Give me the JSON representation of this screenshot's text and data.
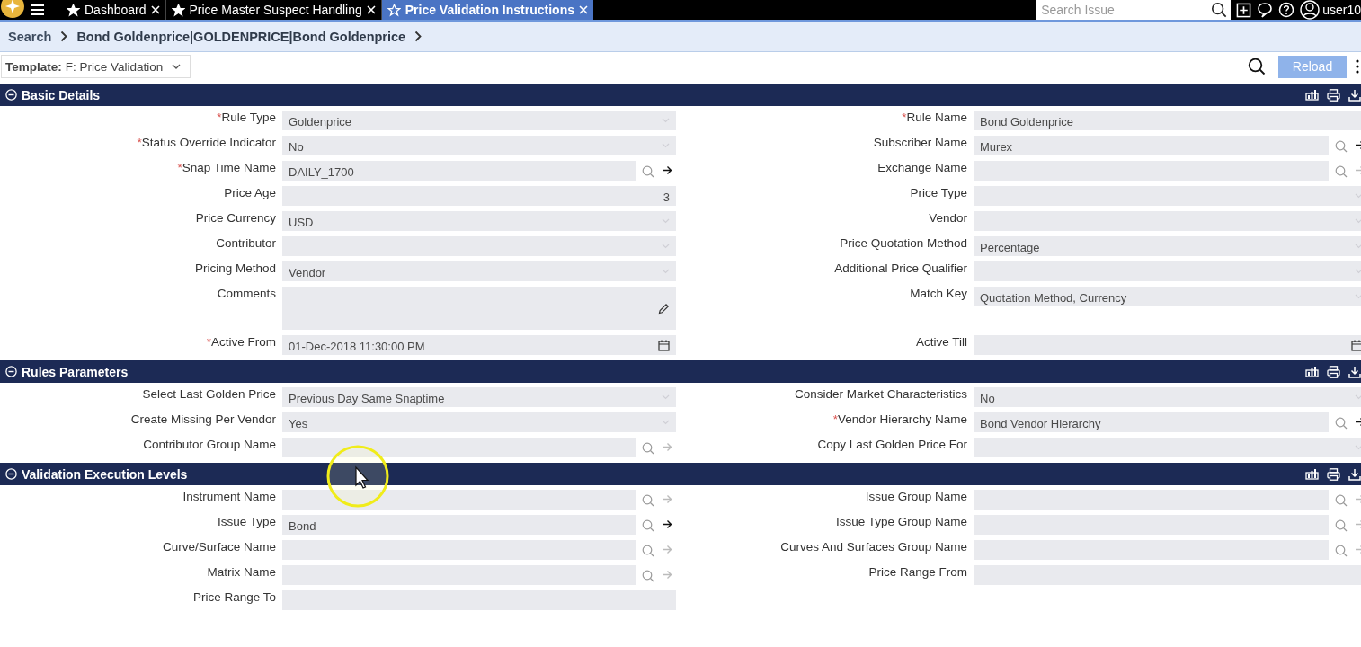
{
  "top_bar": {
    "tabs": [
      {
        "label": "Dashboard",
        "selected": false
      },
      {
        "label": "Price Master Suspect Handling",
        "selected": false
      },
      {
        "label": "Price Validation Instructions",
        "selected": true
      }
    ],
    "search": {
      "placeholder": "Search Issue"
    },
    "user": "user10"
  },
  "breadcrumb": [
    "Search",
    "Bond Goldenprice|GOLDENPRICE|Bond Goldenprice"
  ],
  "template": {
    "label": "Template:",
    "value": "F: Price Validation"
  },
  "reload": {
    "label": "Reload",
    "disabled": true
  },
  "sections": [
    {
      "title": "Basic Details",
      "expanded": true,
      "rows": [
        {
          "left": {
            "label": "Rule Type",
            "required_mark": "*",
            "kind": "select",
            "value": "Goldenprice"
          },
          "right": {
            "label": "Rule Name",
            "required_mark": "*",
            "kind": "text",
            "value": "Bond Goldenprice"
          }
        },
        {
          "left": {
            "label": "Status Override Indicator",
            "required_mark": "*",
            "kind": "select",
            "value": "No"
          },
          "right": {
            "label": "Subscriber Name",
            "kind": "lookup",
            "value": "Murex",
            "link_enabled": true
          }
        },
        {
          "left": {
            "label": "Snap Time Name",
            "required_mark": "*",
            "kind": "lookup",
            "value": "DAILY_1700",
            "link_enabled": true
          },
          "right": {
            "label": "Exchange Name",
            "kind": "lookup",
            "link_enabled": false
          }
        },
        {
          "left": {
            "label": "Price Age",
            "kind": "number",
            "value": "3"
          },
          "right": {
            "label": "Price Type",
            "kind": "select"
          }
        },
        {
          "left": {
            "label": "Price Currency",
            "kind": "select",
            "value": "USD"
          },
          "right": {
            "label": "Vendor",
            "kind": "select"
          }
        },
        {
          "left": {
            "label": "Contributor",
            "kind": "select"
          },
          "right": {
            "label": "Price Quotation Method",
            "kind": "select",
            "value": "Percentage"
          }
        },
        {
          "left": {
            "label": "Pricing Method",
            "kind": "select",
            "value": "Vendor"
          },
          "right": {
            "label": "Additional Price Qualifier",
            "kind": "select"
          }
        },
        {
          "left": {
            "label": "Comments",
            "kind": "textarea"
          },
          "right": {
            "label": "Match Key",
            "kind": "select",
            "value": "Quotation Method, Currency"
          }
        },
        {
          "left": {
            "label": "Active From",
            "required_mark": "*",
            "kind": "date",
            "value": "01-Dec-2018 11:30:00 PM"
          },
          "right": {
            "label": "Active Till",
            "kind": "date"
          }
        }
      ]
    },
    {
      "title": "Rules Parameters",
      "expanded": true,
      "rows": [
        {
          "left": {
            "label": "Select Last Golden Price",
            "kind": "select",
            "value": "Previous Day Same Snaptime"
          },
          "right": {
            "label": "Consider Market Characteristics",
            "kind": "select",
            "value": "No"
          }
        },
        {
          "left": {
            "label": "Create Missing Per Vendor",
            "kind": "select",
            "value": "Yes"
          },
          "right": {
            "label": "Vendor Hierarchy Name",
            "required_mark": "*",
            "kind": "lookup",
            "value": "Bond Vendor Hierarchy",
            "link_enabled": true
          }
        },
        {
          "left": {
            "label": "Contributor Group Name",
            "kind": "lookup",
            "link_enabled": false
          },
          "right": {
            "label": "Copy Last Golden Price For",
            "kind": "select"
          }
        }
      ]
    },
    {
      "title": "Validation Execution Levels",
      "expanded": true,
      "rows": [
        {
          "left": {
            "label": "Instrument Name",
            "kind": "lookup",
            "link_enabled": false
          },
          "right": {
            "label": "Issue Group Name",
            "kind": "lookup",
            "link_enabled": false
          }
        },
        {
          "left": {
            "label": "Issue Type",
            "kind": "lookup",
            "value": "Bond",
            "link_enabled": true
          },
          "right": {
            "label": "Issue Type Group Name",
            "kind": "lookup",
            "link_enabled": false
          }
        },
        {
          "left": {
            "label": "Curve/Surface Name",
            "kind": "lookup",
            "link_enabled": false
          },
          "right": {
            "label": "Curves And Surfaces Group Name",
            "kind": "lookup",
            "link_enabled": false
          }
        },
        {
          "left": {
            "label": "Matrix Name",
            "kind": "lookup",
            "link_enabled": false
          },
          "right": {
            "label": "Price Range From",
            "kind": "text"
          }
        },
        {
          "left": {
            "label": "Price Range To",
            "kind": "text"
          }
        }
      ]
    }
  ]
}
